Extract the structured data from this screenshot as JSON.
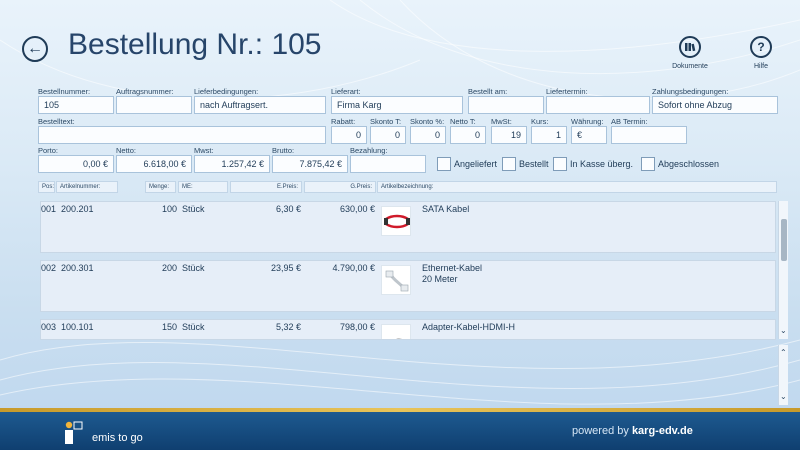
{
  "header": {
    "title": "Bestellung Nr.: 105",
    "documents_label": "Dokumente",
    "help_label": "Hilfe"
  },
  "form": {
    "bestellnummer": {
      "label": "Bestellnummer:",
      "value": "105"
    },
    "auftragsnummer": {
      "label": "Auftragsnummer:",
      "value": ""
    },
    "lieferbedingungen": {
      "label": "Lieferbedingungen:",
      "value": "nach  Auftragsert."
    },
    "lieferart": {
      "label": "Lieferart:",
      "value": "Firma Karg"
    },
    "bestellt_am": {
      "label": "Bestellt am:",
      "value": ""
    },
    "liefertermin": {
      "label": "Liefertermin:",
      "value": ""
    },
    "zahlungsbedingungen": {
      "label": "Zahlungsbedingungen:",
      "value": "Sofort ohne Abzug"
    },
    "bestelltext": {
      "label": "Bestelltext:",
      "value": ""
    },
    "rabatt": {
      "label": "Rabatt:",
      "value": "0"
    },
    "skonto_t": {
      "label": "Skonto T:",
      "value": "0"
    },
    "skonto_pct": {
      "label": "Skonto %:",
      "value": "0"
    },
    "netto_t": {
      "label": "Netto T:",
      "value": "0"
    },
    "mwst_pct": {
      "label": "MwSt:",
      "value": "19"
    },
    "kurs": {
      "label": "Kurs:",
      "value": "1"
    },
    "waehrung": {
      "label": "Währung:",
      "value": "€"
    },
    "ab_termin": {
      "label": "AB Termin:",
      "value": ""
    },
    "porto": {
      "label": "Porto:",
      "value": "0,00 €"
    },
    "netto": {
      "label": "Netto:",
      "value": "6.618,00 €"
    },
    "mwst": {
      "label": "Mwst:",
      "value": "1.257,42 €"
    },
    "brutto": {
      "label": "Brutto:",
      "value": "7.875,42 €"
    },
    "bezahlung": {
      "label": "Bezahlung:",
      "value": ""
    },
    "checkboxes": {
      "angeliefert": "Angeliefert",
      "bestellt": "Bestellt",
      "in_kasse": "In Kasse überg.",
      "abgeschlossen": "Abgeschlossen"
    }
  },
  "table": {
    "columns": [
      "Pos:",
      "Artikelnummer:",
      "Menge:",
      "ME:",
      "E.Preis:",
      "G.Preis:",
      "Artikelbezeichnung:"
    ],
    "rows": [
      {
        "pos": "001",
        "artikel": "200.201",
        "menge": "100",
        "me": "Stück",
        "epreis": "6,30 €",
        "gpreis": "630,00 €",
        "desc1": "SATA Kabel",
        "desc2": "",
        "icon": "sata-cable-thumbnail"
      },
      {
        "pos": "002",
        "artikel": "200.301",
        "menge": "200",
        "me": "Stück",
        "epreis": "23,95 €",
        "gpreis": "4.790,00 €",
        "desc1": "Ethernet-Kabel",
        "desc2": "20 Meter",
        "icon": "ethernet-cable-thumbnail"
      },
      {
        "pos": "003",
        "artikel": "100.101",
        "menge": "150",
        "me": "Stück",
        "epreis": "5,32 €",
        "gpreis": "798,00 €",
        "desc1": "Adapter-Kabel-HDMI-H",
        "desc2": "",
        "icon": "hdmi-cable-thumbnail"
      }
    ]
  },
  "footer": {
    "brand": "emis to go",
    "powered_prefix": "powered by ",
    "powered_brand": "karg-edv.de"
  },
  "colors": {
    "accent": "#1f3b57",
    "footer": "#1e5a90",
    "gold": "#e8c45a"
  }
}
